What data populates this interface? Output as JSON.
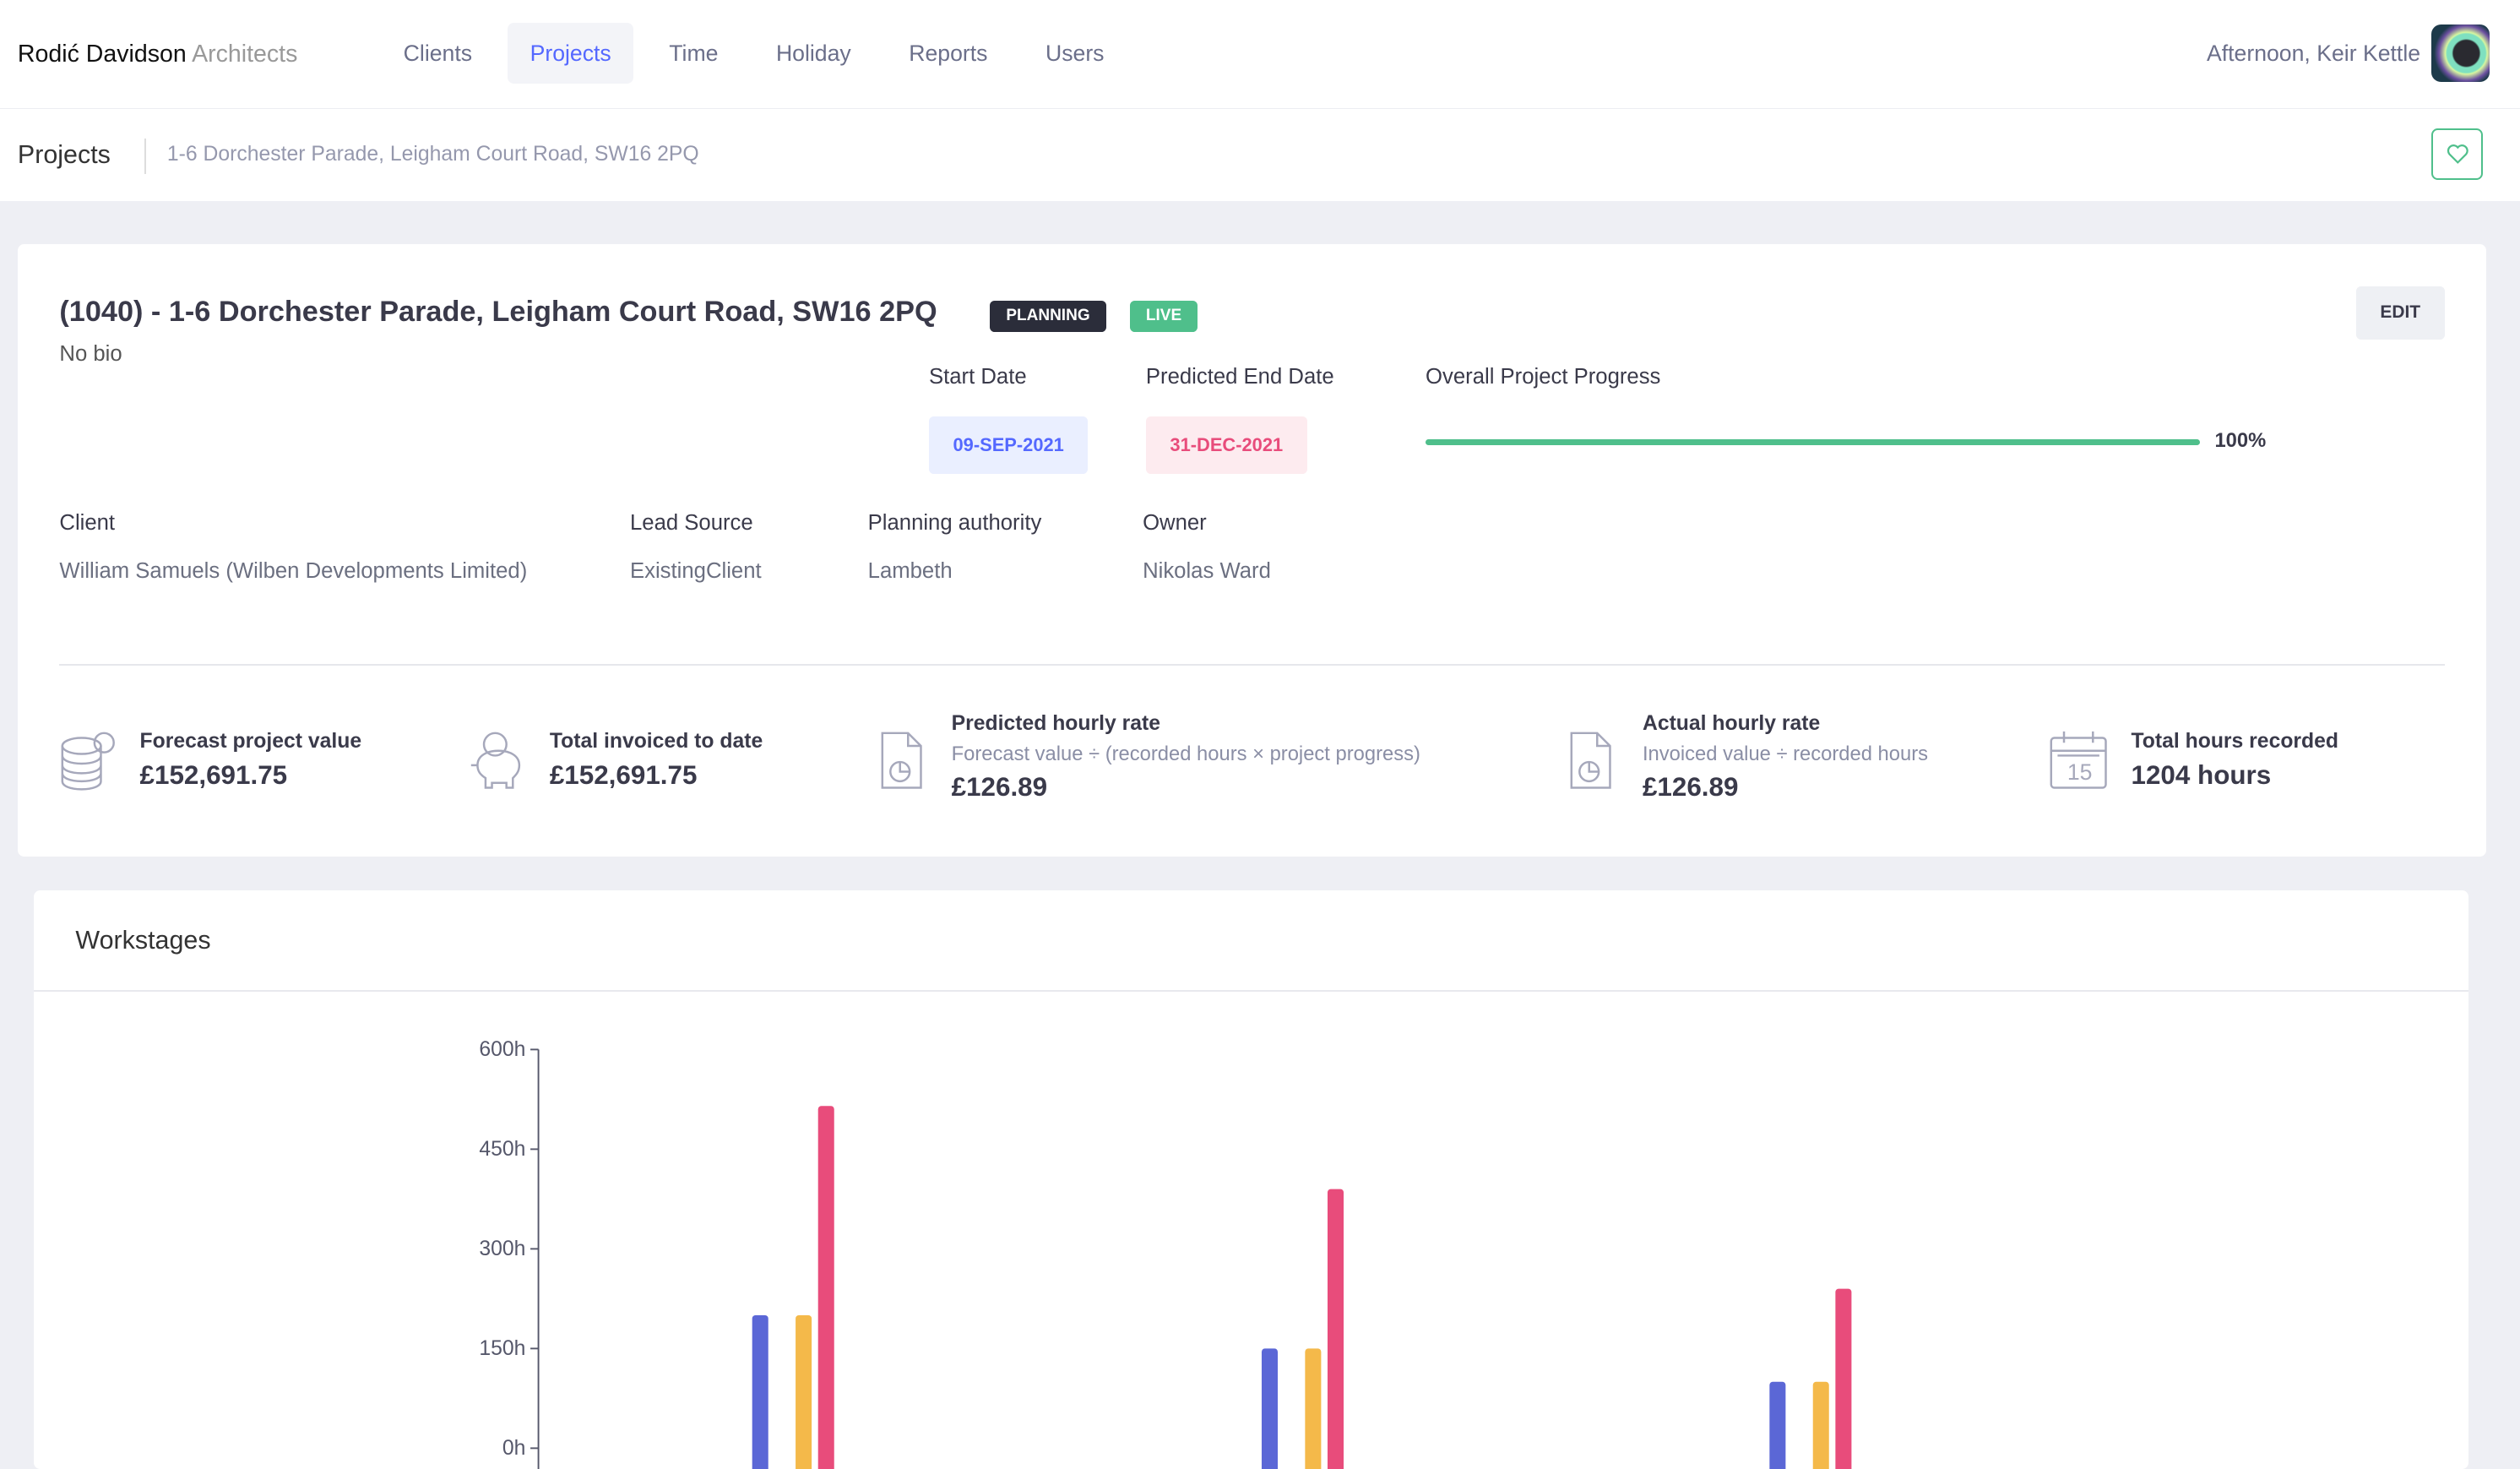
{
  "brand": {
    "name": "Rodić Davidson",
    "suffix": "Architects"
  },
  "nav": [
    {
      "label": "Clients"
    },
    {
      "label": "Projects",
      "active": true
    },
    {
      "label": "Time"
    },
    {
      "label": "Holiday"
    },
    {
      "label": "Reports"
    },
    {
      "label": "Users"
    }
  ],
  "user": {
    "greeting": "Afternoon, Keir Kettle"
  },
  "subheader": {
    "title": "Projects",
    "breadcrumb": "1-6 Dorchester Parade, Leigham Court Road, SW16 2PQ",
    "favourite_icon": "heart-icon"
  },
  "project": {
    "title": "(1040) - 1-6 Dorchester Parade, Leigham Court Road, SW16 2PQ",
    "badges": [
      {
        "label": "PLANNING",
        "color": "#2b2d3a"
      },
      {
        "label": "LIVE",
        "color": "#4fbf8b"
      }
    ],
    "edit_label": "EDIT",
    "bio": "No bio",
    "start_date_label": "Start Date",
    "start_date": "09-SEP-2021",
    "end_date_label": "Predicted End Date",
    "end_date": "31-DEC-2021",
    "progress_label": "Overall Project Progress",
    "progress_percent": 100,
    "progress_text": "100%",
    "fields": [
      {
        "label": "Client",
        "value": "William Samuels (Wilben Developments Limited)"
      },
      {
        "label": "Lead Source",
        "value": "ExistingClient"
      },
      {
        "label": "Planning authority",
        "value": "Lambeth"
      },
      {
        "label": "Owner",
        "value": "Nikolas Ward"
      }
    ],
    "stats": [
      {
        "icon": "coins-icon",
        "label": "Forecast project value",
        "value": "£152,691.75"
      },
      {
        "icon": "piggy-bank-icon",
        "label": "Total invoiced to date",
        "value": "£152,691.75"
      },
      {
        "icon": "document-chart-icon",
        "label": "Predicted hourly rate",
        "formula": "Forecast value ÷ (recorded hours × project progress)",
        "value": "£126.89"
      },
      {
        "icon": "document-chart-icon",
        "label": "Actual hourly rate",
        "formula": "Invoiced value ÷ recorded hours",
        "value": "£126.89"
      },
      {
        "icon": "calendar-icon",
        "label": "Total hours recorded",
        "value": "1204 hours"
      }
    ]
  },
  "workstages": {
    "title": "Workstages"
  },
  "chart_data": {
    "type": "bar",
    "ylim": [
      0,
      600
    ],
    "yticks": [
      "0h",
      "150h",
      "300h",
      "450h",
      "600h"
    ],
    "ytick_values": [
      0,
      150,
      300,
      450,
      600
    ],
    "categories": [
      "",
      "",
      ""
    ],
    "series": [
      {
        "color": "#5b67d6",
        "values": [
          200,
          150,
          100
        ]
      },
      {
        "color": "#f4b94a",
        "values": [
          200,
          150,
          100
        ]
      },
      {
        "color": "#e84c7b",
        "values": [
          515,
          390,
          240
        ]
      }
    ]
  }
}
